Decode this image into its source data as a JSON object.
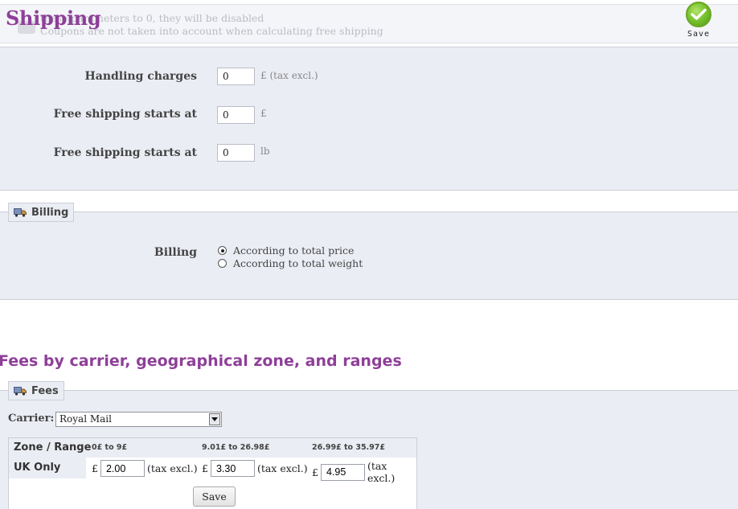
{
  "header": {
    "title": "Shipping",
    "info_line_1": "these parameters to 0, they will be disabled",
    "info_line_2": "Coupons are not taken into account when calculating free shipping",
    "save_label": "Save",
    "save_icon": "check-icon",
    "accent_color": "#8e3f98"
  },
  "general": {
    "handling": {
      "label": "Handling charges",
      "value": "0",
      "unit": "£ (tax excl.)"
    },
    "free_price": {
      "label": "Free shipping starts at",
      "value": "0",
      "unit": "£"
    },
    "free_weight": {
      "label": "Free shipping starts at",
      "value": "0",
      "unit": "lb"
    }
  },
  "billing": {
    "legend": "Billing",
    "icon": "truck-icon",
    "label": "Billing",
    "options": [
      {
        "label": "According to total price",
        "checked": true
      },
      {
        "label": "According to total weight",
        "checked": false
      }
    ]
  },
  "fees_section": {
    "title": "Fees by carrier, geographical zone, and ranges",
    "legend": "Fees",
    "icon": "truck-icon",
    "carrier_label": "Carrier:",
    "carrier_selected": "Royal Mail",
    "table": {
      "zone_header": "Zone / Range",
      "ranges": [
        "0£ to 9£",
        "9.01£ to 26.98£",
        "26.99£ to 35.97£"
      ],
      "rows": [
        {
          "zone": "UK Only",
          "currency": "£",
          "suffix": "(tax excl.)",
          "fees": [
            "2.00",
            "3.30",
            "4.95"
          ]
        }
      ]
    },
    "save_label": "Save"
  }
}
